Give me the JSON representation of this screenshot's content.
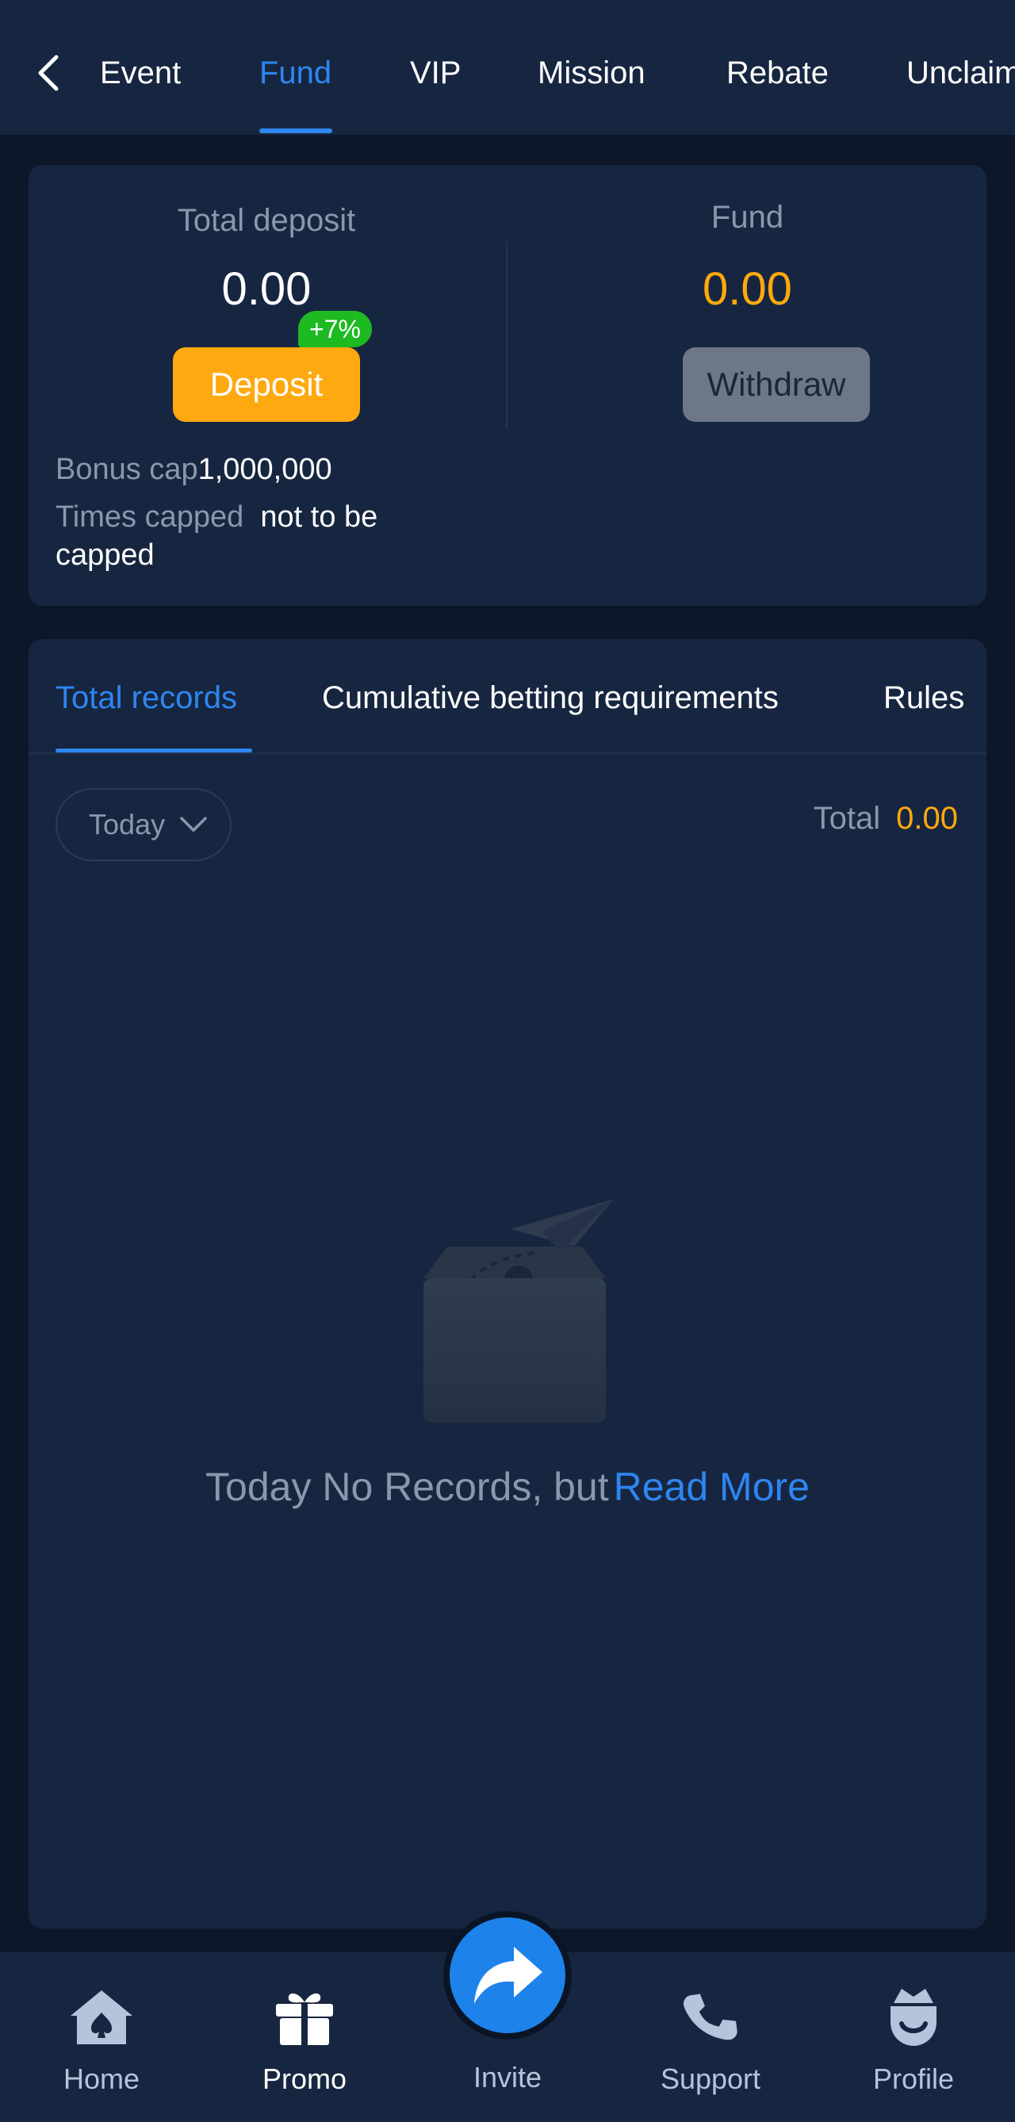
{
  "nav": {
    "tabs": [
      "Event",
      "Fund",
      "VIP",
      "Mission",
      "Rebate",
      "Unclaim"
    ],
    "active_tab": "Fund"
  },
  "summary": {
    "deposit_label": "Total deposit",
    "deposit_value": "0.00",
    "deposit_button": "Deposit",
    "bonus_badge": "+7%",
    "fund_label": "Fund",
    "fund_value": "0.00",
    "withdraw_button": "Withdraw",
    "bonus_cap_label": "Bonus cap",
    "bonus_cap_value": "1,000,000",
    "times_capped_label": "Times capped",
    "times_capped_value_1": "not to be",
    "times_capped_value_2": "capped"
  },
  "records": {
    "tabs": [
      "Total records",
      "Cumulative betting requirements",
      "Rules"
    ],
    "active_tab": "Total records",
    "date_filter": "Today",
    "total_label": "Total",
    "total_value": "0.00",
    "empty_text": "Today No Records, but",
    "read_more": "Read More"
  },
  "bottom_nav": {
    "items": [
      "Home",
      "Promo",
      "Invite",
      "Support",
      "Profile"
    ],
    "active": "Promo"
  },
  "colors": {
    "background": "#0c1729",
    "panel": "#172640",
    "accent_blue": "#2e86f0",
    "accent_orange": "#ffa910",
    "badge_green": "#1dba22",
    "muted_text": "#8a97ad"
  }
}
